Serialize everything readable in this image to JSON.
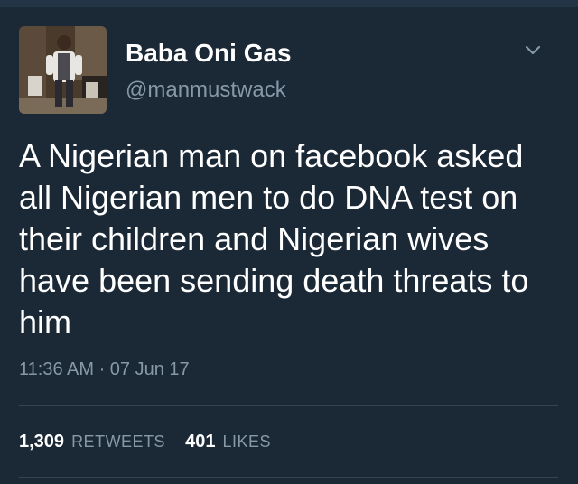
{
  "author": {
    "display_name": "Baba Oni Gas",
    "handle": "@manmustwack",
    "avatar_icon": "profile-photo"
  },
  "tweet": {
    "text": "A Nigerian man on facebook asked all Nigerian men to do DNA test on their children and Nigerian wives have been sending death threats to him",
    "timestamp": "11:36 AM · 07 Jun 17"
  },
  "stats": {
    "retweets_count": "1,309",
    "retweets_label": "RETWEETS",
    "likes_count": "401",
    "likes_label": "LIKES"
  },
  "icons": {
    "menu": "chevron-down-icon"
  },
  "colors": {
    "background": "#1b2836",
    "primary_text": "#ffffff",
    "secondary_text": "#8899a6",
    "divider": "#38444d"
  }
}
